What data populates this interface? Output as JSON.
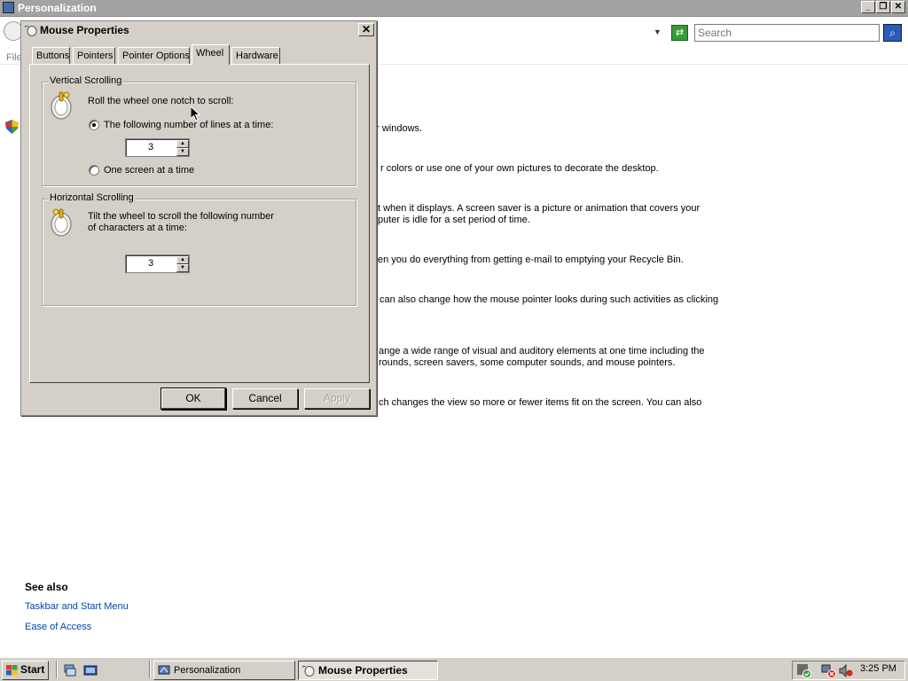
{
  "personalization": {
    "title": "Personalization",
    "search_placeholder": "Search",
    "menu_file": "File",
    "lines": [
      "ur windows.",
      "r colors or use one of your own pictures to decorate the desktop.",
      "t when it displays. A screen saver is a picture or animation that covers your",
      "puter is idle for a set period of time.",
      "en you do everything from getting e-mail to emptying your Recycle Bin.",
      "can also change how the mouse pointer looks during such activities as clicking",
      "ange a wide range of visual and auditory elements at one time including the",
      "rounds, screen savers, some computer sounds, and mouse pointers.",
      "ch changes the view so more or fewer items fit on the screen. You can also"
    ],
    "see_also": "See also",
    "links": [
      "Taskbar and Start Menu",
      "Ease of Access"
    ]
  },
  "dialog": {
    "title": "Mouse Properties",
    "tabs": [
      "Buttons",
      "Pointers",
      "Pointer Options",
      "Wheel",
      "Hardware"
    ],
    "active_tab": "Wheel",
    "vertical": {
      "label": "Vertical Scrolling",
      "desc": "Roll the wheel one notch to scroll:",
      "option_lines": "The following number of lines at a time:",
      "lines_value": "3",
      "option_screen": "One screen at a time",
      "selected": "lines"
    },
    "horizontal": {
      "label": "Horizontal Scrolling",
      "desc_line1": "Tilt the wheel to scroll the following number",
      "desc_line2": "of characters at a time:",
      "chars_value": "3"
    },
    "buttons": {
      "ok": "OK",
      "cancel": "Cancel",
      "apply": "Apply"
    }
  },
  "taskbar": {
    "start": "Start",
    "tasks": [
      "Personalization",
      "Mouse Properties"
    ],
    "active_task": "Mouse Properties",
    "clock": "3:25 PM"
  }
}
